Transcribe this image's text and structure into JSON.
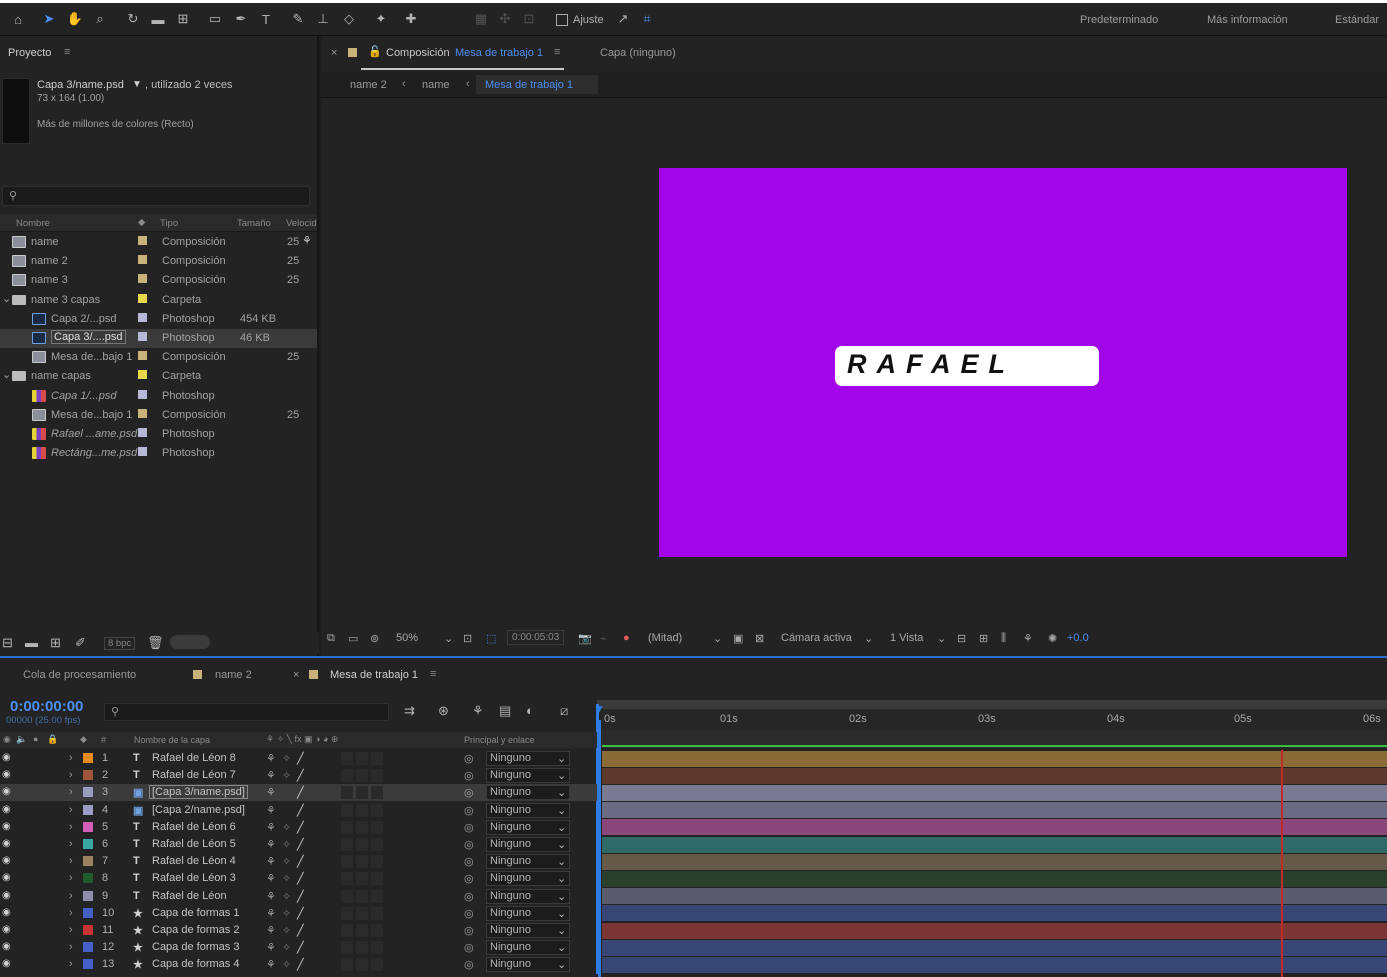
{
  "toolbar": {
    "snap_label": "Ajuste",
    "workspaces": [
      "Predeterminado",
      "Más información",
      "Estándar"
    ]
  },
  "project": {
    "tab_label": "Proyecto",
    "selected_name": "Capa 3/name.psd",
    "selected_usage": ", utilizado 2 veces",
    "selected_dims": "73 x 164 (1.00)",
    "selected_colors": "Más de millones de colores (Recto)",
    "columns": [
      "Nombre",
      "Tipo",
      "Tamaño",
      "Velocid"
    ],
    "items": [
      {
        "name": "name",
        "type": "Composición",
        "size": "",
        "rate": "25",
        "kind": "comp",
        "color": "#c9b27a",
        "indent": 0
      },
      {
        "name": "name 2",
        "type": "Composición",
        "size": "",
        "rate": "25",
        "kind": "comp",
        "color": "#c9b27a",
        "indent": 0
      },
      {
        "name": "name 3",
        "type": "Composición",
        "size": "",
        "rate": "25",
        "kind": "comp",
        "color": "#c9b27a",
        "indent": 0
      },
      {
        "name": "name 3 capas",
        "type": "Carpeta",
        "size": "",
        "rate": "",
        "kind": "folder",
        "color": "#e7d74a",
        "indent": 0
      },
      {
        "name": "Capa 2/...psd",
        "type": "Photoshop",
        "size": "454 KB",
        "rate": "",
        "kind": "psd",
        "color": "#b7b7d8",
        "indent": 1
      },
      {
        "name": "Capa 3/....psd",
        "type": "Photoshop",
        "size": "46 KB",
        "rate": "",
        "kind": "psd",
        "color": "#b7b7d8",
        "indent": 1
      },
      {
        "name": "Mesa de...bajo 1",
        "type": "Composición",
        "size": "",
        "rate": "25",
        "kind": "comp",
        "color": "#c9b27a",
        "indent": 1
      },
      {
        "name": "name capas",
        "type": "Carpeta",
        "size": "",
        "rate": "",
        "kind": "folder",
        "color": "#e7d74a",
        "indent": 0
      },
      {
        "name": "Capa 1/...psd",
        "type": "Photoshop",
        "size": "",
        "rate": "",
        "kind": "psdimg",
        "color": "#b7b7d8",
        "indent": 1
      },
      {
        "name": "Mesa de...bajo 1",
        "type": "Composición",
        "size": "",
        "rate": "25",
        "kind": "comp",
        "color": "#c9b27a",
        "indent": 1
      },
      {
        "name": "Rafael ...ame.psd",
        "type": "Photoshop",
        "size": "",
        "rate": "",
        "kind": "psdimg",
        "color": "#b7b7d8",
        "indent": 1
      },
      {
        "name": "Rectáng...me.psd",
        "type": "Photoshop",
        "size": "",
        "rate": "",
        "kind": "psdimg",
        "color": "#b7b7d8",
        "indent": 1
      }
    ],
    "bpc": "8 bpc"
  },
  "viewer": {
    "comp_prefix": "Composición",
    "comp_name": "Mesa de trabajo 1",
    "layer_tab": "Capa (ninguno)",
    "breadcrumbs": [
      "name 2",
      "name",
      "Mesa de trabajo 1"
    ],
    "artboard_text": "RAFAEL",
    "artboard_color": "#a305ea",
    "zoom": "50%",
    "timecode": "0:00:05:03",
    "resolution": "(Mitad)",
    "camera": "Cámara activa",
    "views": "1 Vista",
    "exposure": "+0.0"
  },
  "timeline": {
    "tabs": [
      "Cola de procesamiento",
      "name 2",
      "Mesa de trabajo 1"
    ],
    "current_time": "0:00:00:00",
    "frame_info": "00000 (25.00 fps)",
    "col_layer_name": "Nombre de la capa",
    "col_parent": "Principal y enlace",
    "ruler": [
      "0s",
      "01s",
      "02s",
      "03s",
      "04s",
      "05s",
      "06s"
    ],
    "layers": [
      {
        "num": "1",
        "name": "Rafael de Léon 8",
        "type": "text",
        "color": "#e88b1f",
        "bar": "#8a6a35"
      },
      {
        "num": "2",
        "name": "Rafael de Léon 7",
        "type": "text",
        "color": "#a05538",
        "bar": "#5e3a2e"
      },
      {
        "num": "3",
        "name": "[Capa 3/name.psd]",
        "type": "psd",
        "color": "#9a9ac4",
        "bar": "#7a7a93"
      },
      {
        "num": "4",
        "name": "[Capa 2/name.psd]",
        "type": "psd",
        "color": "#9a9ac4",
        "bar": "#6b6b83"
      },
      {
        "num": "5",
        "name": "Rafael de Léon 6",
        "type": "text",
        "color": "#d35fb4",
        "bar": "#8a477b"
      },
      {
        "num": "6",
        "name": "Rafael de Léon 5",
        "type": "text",
        "color": "#3aa7a0",
        "bar": "#2f6a68"
      },
      {
        "num": "7",
        "name": "Rafael de Léon 4",
        "type": "text",
        "color": "#9b8362",
        "bar": "#645a47"
      },
      {
        "num": "8",
        "name": "Rafael de Léon 3",
        "type": "text",
        "color": "#1f5a2c",
        "bar": "#2a3f2d"
      },
      {
        "num": "9",
        "name": "Rafael de Léon",
        "type": "text",
        "color": "#8e8ea8",
        "bar": "#5b5b6e"
      },
      {
        "num": "10",
        "name": "Capa de formas 1",
        "type": "shape",
        "color": "#4560c8",
        "bar": "#384676"
      },
      {
        "num": "11",
        "name": "Capa de formas 2",
        "type": "shape",
        "color": "#c83434",
        "bar": "#7a3534"
      },
      {
        "num": "12",
        "name": "Capa de formas 3",
        "type": "shape",
        "color": "#4560c8",
        "bar": "#384676"
      },
      {
        "num": "13",
        "name": "Capa de formas 4",
        "type": "shape",
        "color": "#4560c8",
        "bar": "#384676"
      }
    ],
    "parent_value": "Ninguno"
  }
}
